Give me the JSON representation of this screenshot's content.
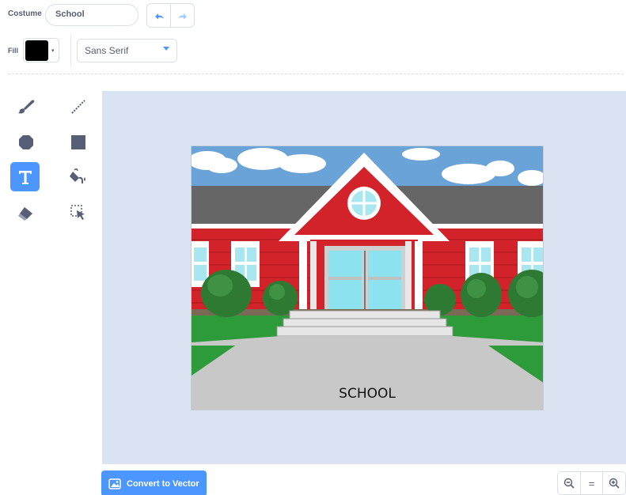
{
  "toolbar": {
    "costume_label": "Costume",
    "costume_name": "School",
    "undo_icon": "undo-icon",
    "redo_icon": "redo-icon",
    "fill_label": "Fill",
    "fill_color": "#000000",
    "font_family": "Sans Serif"
  },
  "tools": [
    {
      "name": "brush-icon",
      "active": false
    },
    {
      "name": "line-icon",
      "active": false
    },
    {
      "name": "circle-icon",
      "active": false
    },
    {
      "name": "rectangle-icon",
      "active": false
    },
    {
      "name": "text-icon",
      "active": true
    },
    {
      "name": "fill-bucket-icon",
      "active": false
    },
    {
      "name": "eraser-icon",
      "active": false
    },
    {
      "name": "select-icon",
      "active": false
    }
  ],
  "canvas": {
    "image_subject": "school-building",
    "text": "SCHOOL"
  },
  "footer": {
    "convert_label": "Convert to Vector",
    "zoom_out_icon": "zoom-out-icon",
    "zoom_reset_label": "=",
    "zoom_in_icon": "zoom-in-icon"
  },
  "colors": {
    "accent": "#4c97ff",
    "canvas_bg": "#d9e3f2",
    "wall_red": "#d2232a",
    "roof_gray": "#666666",
    "grass": "#2e9b3a",
    "sky": "#6aa3d8"
  }
}
